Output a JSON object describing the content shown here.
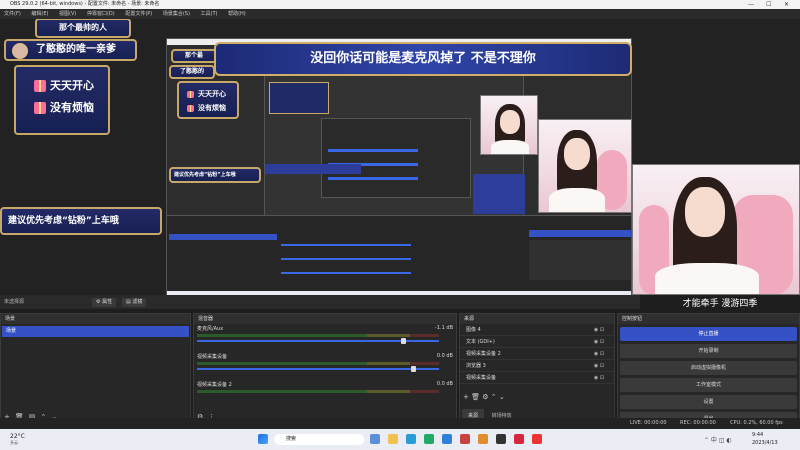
{
  "window": {
    "title": "OBS 29.0.2 (64-bit, windows) - 配置文件: 未命名 - 场景: 未命名"
  },
  "menu": [
    "文件(F)",
    "编辑(E)",
    "视图(V)",
    "停靠窗口(D)",
    "配置文件(P)",
    "场景集合(S)",
    "工具(T)",
    "帮助(H)"
  ],
  "overlay": {
    "header_small": "那个最帅的人",
    "header_main": "了憨憨的唯一亲爹",
    "wish1": "天天开心",
    "wish2": "没有烦恼",
    "notice": "建议优先考虑“钻粉”上车哦",
    "banner": "没回你话可能是麦克风掉了 不是不理你",
    "nested_header": "那个最",
    "nested_main": "了憨憨的"
  },
  "caption": "才能牵手 漫游四季",
  "preview_toolbar": {
    "title": "未选择源",
    "props": "属性",
    "filters": "滤镜"
  },
  "scenes": {
    "title": "场景",
    "items": [
      "场景"
    ]
  },
  "mixer": {
    "title": "混音器",
    "channels": [
      {
        "name": "麦克风/Aux",
        "db": "-1.1 dB"
      },
      {
        "name": "视频采集设备",
        "db": "0.0 dB"
      },
      {
        "name": "视频采集设备 2",
        "db": "0.0 dB"
      }
    ]
  },
  "sources": {
    "title": "来源",
    "items": [
      "图像 4",
      "文本 (GDI+)",
      "视频采集设备 2",
      "浏览器 3",
      "视频采集设备"
    ],
    "tabs": [
      "来源",
      "转场特效"
    ]
  },
  "controls": {
    "title": "控制按钮",
    "buttons": [
      "停止直播",
      "开始录制",
      "启动虚拟摄像机",
      "工作室模式",
      "设置",
      "退出"
    ]
  },
  "status": {
    "live": "LIVE: 00:00:00",
    "rec": "REC: 00:00:00",
    "cpu": "CPU: 0.2%, 60.00 fps"
  },
  "taskbar": {
    "weather": "22°C",
    "weather_sub": "多云",
    "search": "搜索",
    "time": "9:44",
    "date": "2023/4/13"
  }
}
